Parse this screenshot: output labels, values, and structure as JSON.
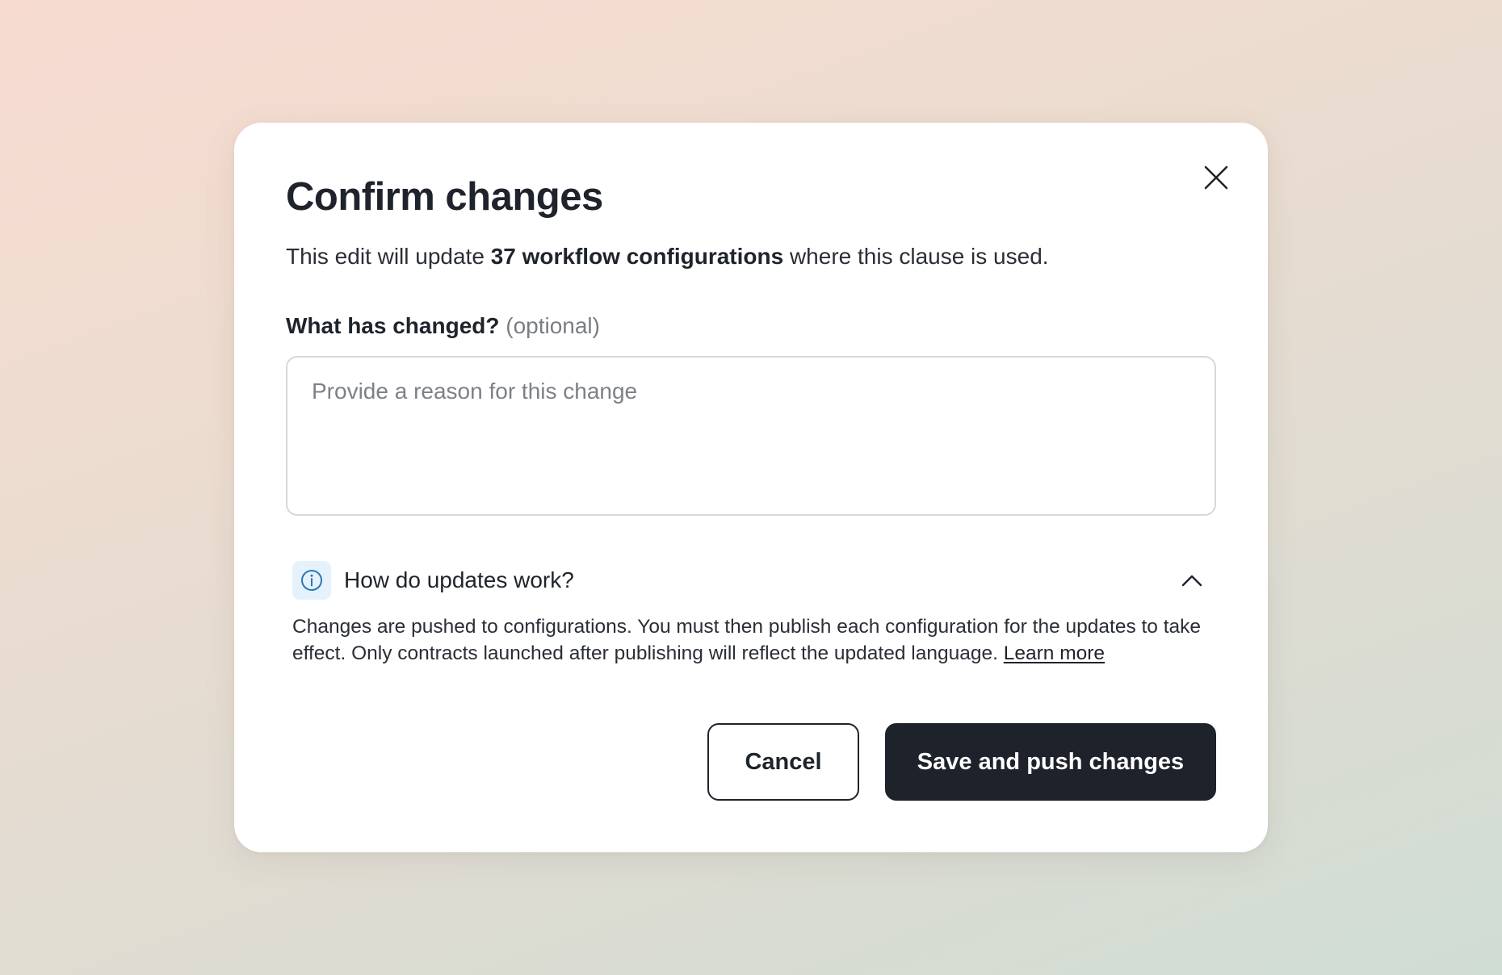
{
  "dialog": {
    "title": "Confirm changes",
    "subtitle_prefix": "This edit will update ",
    "subtitle_bold": "37 workflow configurations",
    "subtitle_suffix": " where this clause is used.",
    "close_icon": "close-icon"
  },
  "reason_field": {
    "label": "What has changed?",
    "optional_tag": "(optional)",
    "placeholder": "Provide a reason for this change",
    "value": ""
  },
  "info_section": {
    "icon": "info-icon",
    "title": "How do updates work?",
    "expanded": true,
    "toggle_icon": "chevron-up-icon",
    "body": "Changes are pushed to configurations. You must then publish each configuration for the updates to take effect. Only contracts launched after publishing will reflect the updated language. ",
    "link_label": "Learn more"
  },
  "actions": {
    "cancel_label": "Cancel",
    "primary_label": "Save and push changes"
  },
  "colors": {
    "primary_button": "#1e222b",
    "info_icon": "#2b77b8",
    "info_icon_bg": "#e6f2fb",
    "placeholder": "#7d8087"
  }
}
